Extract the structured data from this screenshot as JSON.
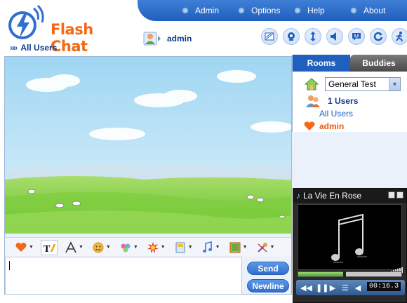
{
  "app": {
    "logo_text": "Flash Chat",
    "accent": "#1f5fbd",
    "brand_orange": "#f46a12"
  },
  "top_menu": [
    {
      "label": "Admin"
    },
    {
      "label": "Options"
    },
    {
      "label": "Help"
    },
    {
      "label": "About"
    }
  ],
  "header": {
    "view_label": "All Users",
    "current_user": "admin"
  },
  "toolbar_icons": [
    "skin-icon",
    "webcam-icon",
    "resize-icon",
    "sound-icon",
    "smiley-status-icon",
    "refresh-icon",
    "logout-icon"
  ],
  "input_toolbar_icons": [
    "heart-icon",
    "text-format-icon",
    "font-icon",
    "smiley-icon",
    "emoticons-icon",
    "effects-icon",
    "save-icon",
    "music-icon",
    "image-icon",
    "settings-icon"
  ],
  "message": {
    "value": ""
  },
  "buttons": {
    "send": "Send",
    "newline": "Newline"
  },
  "right_panel": {
    "tabs": [
      {
        "label": "Rooms",
        "active": true
      },
      {
        "label": "Buddies",
        "active": false
      }
    ],
    "room_select": {
      "selected": "General Test"
    },
    "users_count": "1 Users",
    "all_users_link": "All Users",
    "users": [
      {
        "name": "admin"
      }
    ]
  },
  "player": {
    "track_title": "La Vie En Rose",
    "time": "00:16.3",
    "progress": 0.45
  }
}
